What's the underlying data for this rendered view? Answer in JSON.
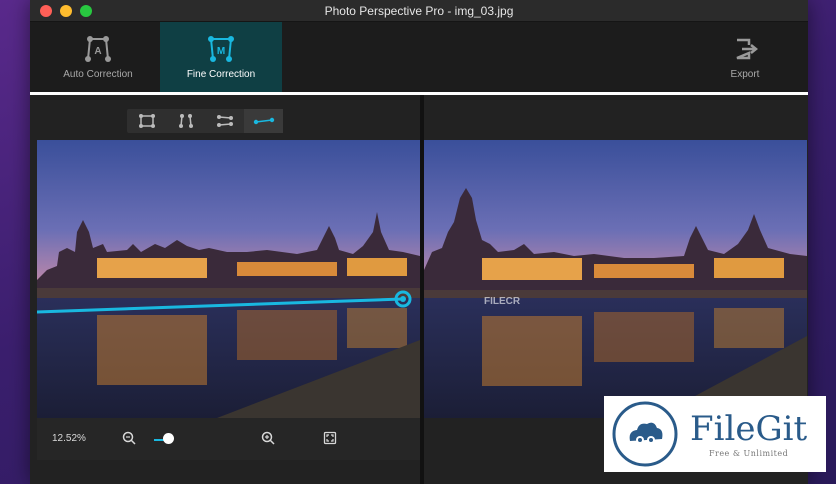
{
  "window": {
    "title": "Photo Perspective Pro - img_03.jpg"
  },
  "toolbar": {
    "auto_correction": {
      "label": "Auto Correction",
      "icon": "auto-correction-icon"
    },
    "fine_correction": {
      "label": "Fine Correction",
      "icon": "fine-correction-icon",
      "active": true
    },
    "export": {
      "label": "Export",
      "icon": "export-icon"
    }
  },
  "tools": [
    {
      "name": "rectangle-tool",
      "active": false
    },
    {
      "name": "vertical-lines-tool",
      "active": false
    },
    {
      "name": "horizontal-lines-tool",
      "active": false
    },
    {
      "name": "horizon-line-tool",
      "active": true
    }
  ],
  "zoom": {
    "value": "12.52%",
    "level": 0.3
  },
  "watermark": {
    "brand": "FileGit",
    "tagline": "Free & Unlimited",
    "overlay_text": "FILECR"
  },
  "colors": {
    "accent": "#19b8e0",
    "active_tab": "#0f3f44",
    "brand": "#2a5b8a"
  }
}
